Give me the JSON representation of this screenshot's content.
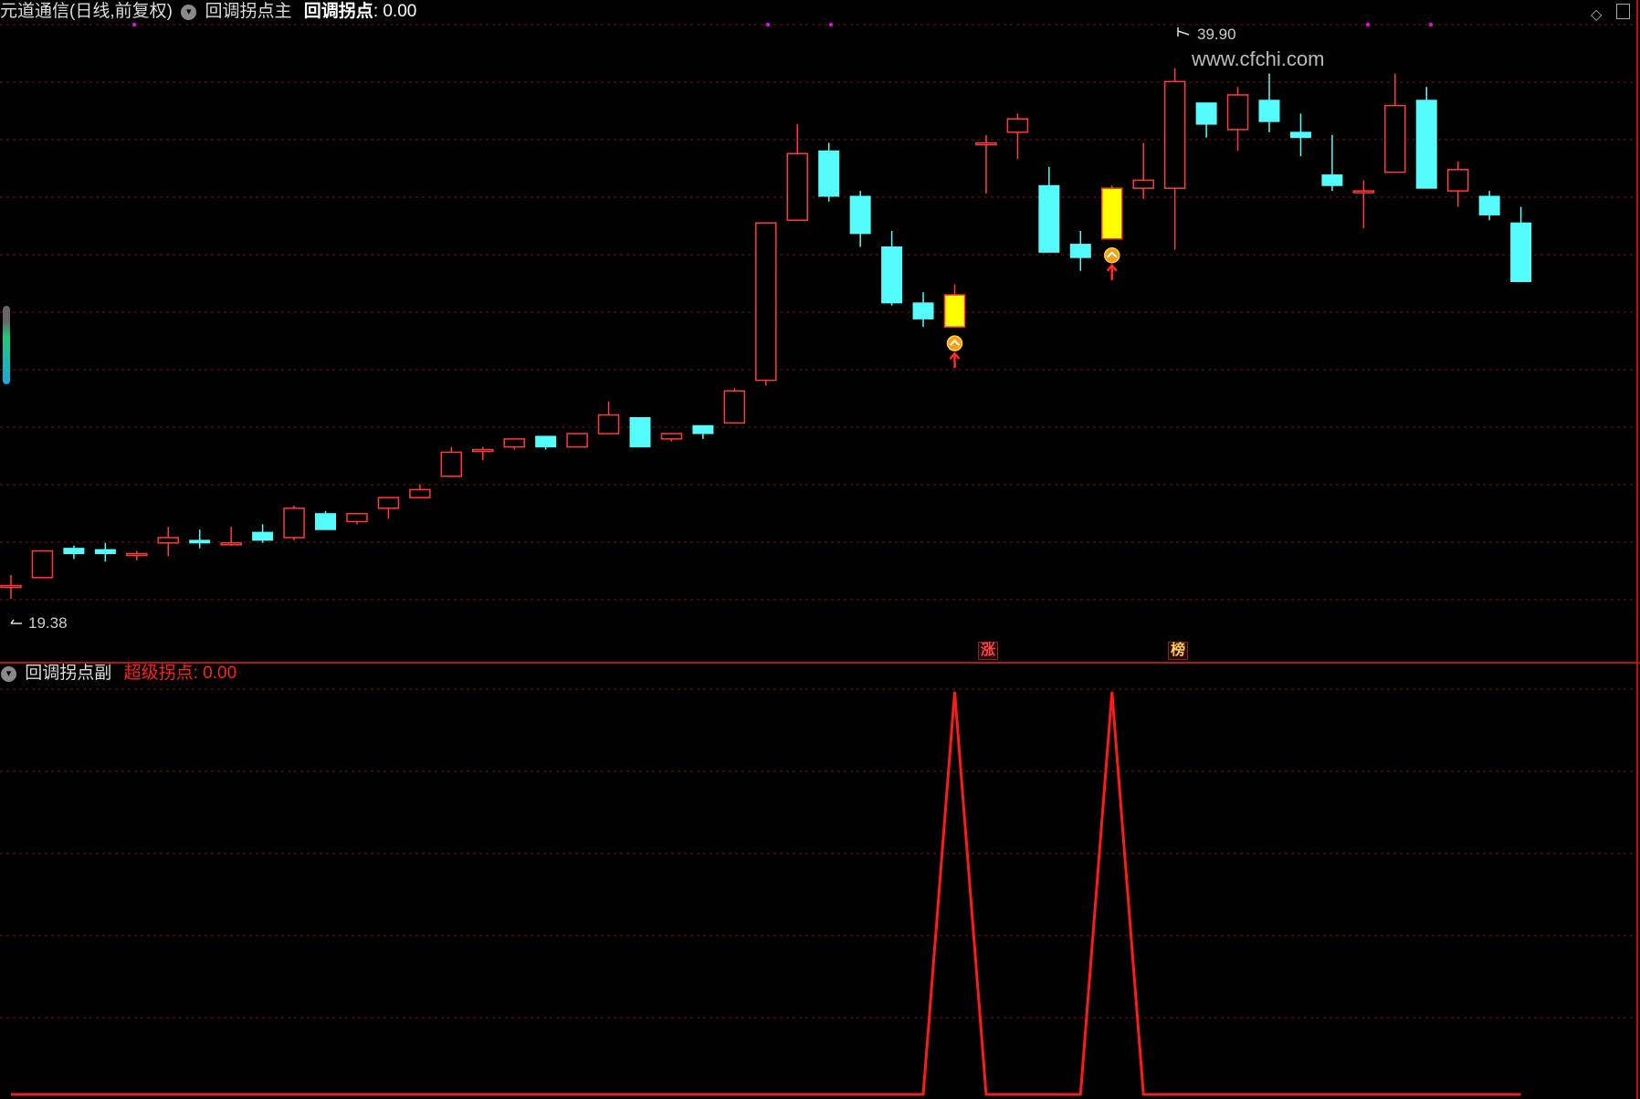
{
  "main_panel": {
    "stock_title": "元道通信(日线,前复权)",
    "indicator_name": "回调拐点主",
    "value_label": "回调拐点",
    "value": ": 0.00",
    "high_label": "39.90",
    "low_label": "19.38",
    "watermark": "www.cfchi.com",
    "tag_zhang": "涨",
    "tag_bang": "榜"
  },
  "sub_panel": {
    "indicator_name": "回调拐点副",
    "value_label": "超级拐点",
    "value": ": 0.00"
  },
  "colors": {
    "background": "#000000",
    "up": "#ff3b3b",
    "down": "#54fcfc",
    "signal": "#ffff00",
    "grid": "#7a1515",
    "line": "#ff1a1a",
    "magenta": "#ff00ff"
  },
  "icons": [
    "collapse-circle-icon",
    "diamond-icon",
    "panel-toggle-icon",
    "up-arrow-icon",
    "signal-marker-icon"
  ],
  "chart_data": [
    {
      "type": "candlestick",
      "title": "元道通信(日线,前复权)",
      "ylim": [
        18.6,
        41.6
      ],
      "candles": [
        {
          "o": 20.6,
          "h": 21.0,
          "l": 20.1,
          "c": 20.6
        },
        {
          "o": 20.9,
          "h": 21.9,
          "l": 20.9,
          "c": 21.9
        },
        {
          "o": 22.0,
          "h": 22.1,
          "l": 21.6,
          "c": 21.8
        },
        {
          "o": 21.95,
          "h": 22.2,
          "l": 21.5,
          "c": 21.8
        },
        {
          "o": 21.75,
          "h": 21.9,
          "l": 21.55,
          "c": 21.8
        },
        {
          "o": 22.2,
          "h": 22.8,
          "l": 21.7,
          "c": 22.4
        },
        {
          "o": 22.3,
          "h": 22.7,
          "l": 22.0,
          "c": 22.2
        },
        {
          "o": 22.15,
          "h": 22.8,
          "l": 22.1,
          "c": 22.2
        },
        {
          "o": 22.6,
          "h": 22.9,
          "l": 22.2,
          "c": 22.3
        },
        {
          "o": 22.4,
          "h": 23.6,
          "l": 22.3,
          "c": 23.5
        },
        {
          "o": 23.3,
          "h": 23.4,
          "l": 22.7,
          "c": 22.7
        },
        {
          "o": 23.0,
          "h": 23.3,
          "l": 22.9,
          "c": 23.3
        },
        {
          "o": 23.5,
          "h": 23.9,
          "l": 23.1,
          "c": 23.9
        },
        {
          "o": 23.9,
          "h": 24.4,
          "l": 23.9,
          "c": 24.2
        },
        {
          "o": 24.7,
          "h": 25.8,
          "l": 24.7,
          "c": 25.6
        },
        {
          "o": 25.7,
          "h": 25.8,
          "l": 25.3,
          "c": 25.7
        },
        {
          "o": 25.8,
          "h": 26.1,
          "l": 25.7,
          "c": 26.1
        },
        {
          "o": 26.2,
          "h": 26.2,
          "l": 25.7,
          "c": 25.8
        },
        {
          "o": 25.8,
          "h": 26.2,
          "l": 25.8,
          "c": 26.3
        },
        {
          "o": 26.3,
          "h": 27.5,
          "l": 26.3,
          "c": 27.0
        },
        {
          "o": 26.9,
          "h": 26.8,
          "l": 25.8,
          "c": 25.8
        },
        {
          "o": 26.1,
          "h": 26.3,
          "l": 26.0,
          "c": 26.3
        },
        {
          "o": 26.6,
          "h": 26.6,
          "l": 26.1,
          "c": 26.3
        },
        {
          "o": 26.7,
          "h": 28.0,
          "l": 26.7,
          "c": 27.9
        },
        {
          "o": 28.3,
          "h": 34.2,
          "l": 28.1,
          "c": 34.2
        },
        {
          "o": 34.3,
          "h": 37.9,
          "l": 34.3,
          "c": 36.8
        },
        {
          "o": 36.9,
          "h": 37.2,
          "l": 35.0,
          "c": 35.2
        },
        {
          "o": 35.2,
          "h": 35.4,
          "l": 33.3,
          "c": 33.8
        },
        {
          "o": 33.3,
          "h": 33.9,
          "l": 31.1,
          "c": 31.2
        },
        {
          "o": 31.2,
          "h": 31.6,
          "l": 30.3,
          "c": 30.6
        },
        {
          "o": 30.3,
          "h": 31.9,
          "l": 30.3,
          "c": 31.5,
          "signal": true
        },
        {
          "o": 37.2,
          "h": 37.5,
          "l": 35.3,
          "c": 37.2
        },
        {
          "o": 37.6,
          "h": 38.3,
          "l": 36.6,
          "c": 38.1
        },
        {
          "o": 35.6,
          "h": 36.3,
          "l": 33.1,
          "c": 33.1
        },
        {
          "o": 33.4,
          "h": 33.9,
          "l": 32.4,
          "c": 32.9
        },
        {
          "o": 33.6,
          "h": 35.6,
          "l": 33.6,
          "c": 35.5,
          "signal": true
        },
        {
          "o": 35.5,
          "h": 37.2,
          "l": 35.1,
          "c": 35.8
        },
        {
          "o": 35.5,
          "h": 40.0,
          "l": 33.2,
          "c": 39.5
        },
        {
          "o": 38.7,
          "h": 38.7,
          "l": 37.4,
          "c": 37.9
        },
        {
          "o": 37.7,
          "h": 39.3,
          "l": 36.9,
          "c": 39.0
        },
        {
          "o": 38.8,
          "h": 39.8,
          "l": 37.6,
          "c": 38.0
        },
        {
          "o": 37.6,
          "h": 38.3,
          "l": 36.7,
          "c": 37.4
        },
        {
          "o": 36.0,
          "h": 37.5,
          "l": 35.4,
          "c": 35.6
        },
        {
          "o": 35.4,
          "h": 35.8,
          "l": 34.0,
          "c": 35.4
        },
        {
          "o": 36.1,
          "h": 39.8,
          "l": 36.1,
          "c": 38.6
        },
        {
          "o": 38.8,
          "h": 39.3,
          "l": 35.5,
          "c": 35.5
        },
        {
          "o": 35.4,
          "h": 36.5,
          "l": 34.8,
          "c": 36.2
        },
        {
          "o": 35.2,
          "h": 35.4,
          "l": 34.3,
          "c": 34.5
        },
        {
          "o": 34.2,
          "h": 34.8,
          "l": 32.0,
          "c": 32.0
        }
      ],
      "annotations": [
        "39.90",
        "19.38"
      ]
    },
    {
      "type": "line",
      "title": "回调拐点副",
      "series": [
        {
          "name": "超级拐点",
          "values": [
            0,
            0,
            0,
            0,
            0,
            0,
            0,
            0,
            0,
            0,
            0,
            0,
            0,
            0,
            0,
            0,
            0,
            0,
            0,
            0,
            0,
            0,
            0,
            0,
            0,
            0,
            0,
            0,
            0,
            0,
            1,
            0,
            0,
            0,
            0,
            1,
            0,
            0,
            0,
            0,
            0,
            0,
            0,
            0,
            0,
            0,
            0,
            0,
            0
          ]
        }
      ],
      "ylim": [
        0,
        1
      ]
    }
  ]
}
